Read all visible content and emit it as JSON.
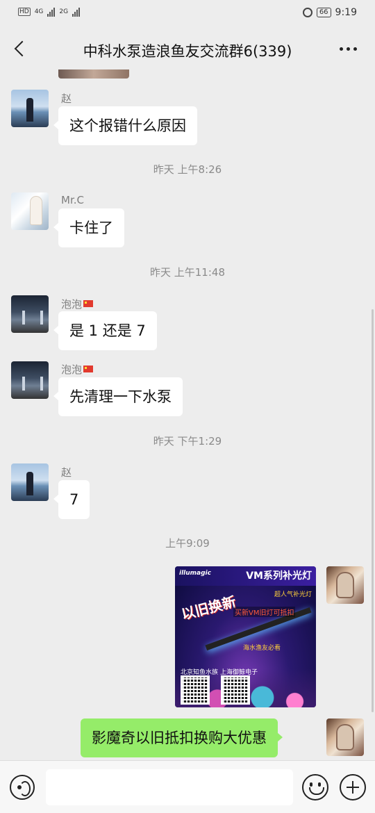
{
  "status_bar": {
    "hd": "HD",
    "net1": "4G",
    "net2": "2G",
    "battery": "66",
    "time": "9:19"
  },
  "header": {
    "title": "中科水泵造浪鱼友交流群6(339)"
  },
  "messages": [
    {
      "sender": "赵",
      "text": "这个报错什么原因"
    },
    {
      "time": "昨天 上午8:26"
    },
    {
      "sender": "Mr.C",
      "text": "卡住了"
    },
    {
      "time": "昨天 上午11:48"
    },
    {
      "sender": "泡泡",
      "text": "是 1 还是 7"
    },
    {
      "sender": "泡泡",
      "text": "先清理一下水泵"
    },
    {
      "time": "昨天 下午1:29"
    },
    {
      "sender": "赵",
      "text": "7"
    },
    {
      "time": "上午9:09"
    },
    {
      "text": "影魔奇以旧抵扣换购大优惠"
    }
  ],
  "promo_image": {
    "brand": "illumagic",
    "title": "VM系列补光灯",
    "subtitle": "超人气补光灯",
    "swap": "以旧换新",
    "deal": "买新VM旧灯可抵扣",
    "ocean": "海水渔友必看",
    "north": "北京知鱼水族",
    "shanghai": "上海御鲸电子"
  },
  "input": {
    "placeholder": ""
  },
  "icons": {
    "back": "chevron-left-icon",
    "more": "more-dots-icon",
    "voice": "voice-icon",
    "emoji": "emoji-icon",
    "plus": "plus-icon"
  },
  "colors": {
    "background": "#ededed",
    "my_bubble": "#95ec69",
    "other_bubble": "#ffffff"
  }
}
